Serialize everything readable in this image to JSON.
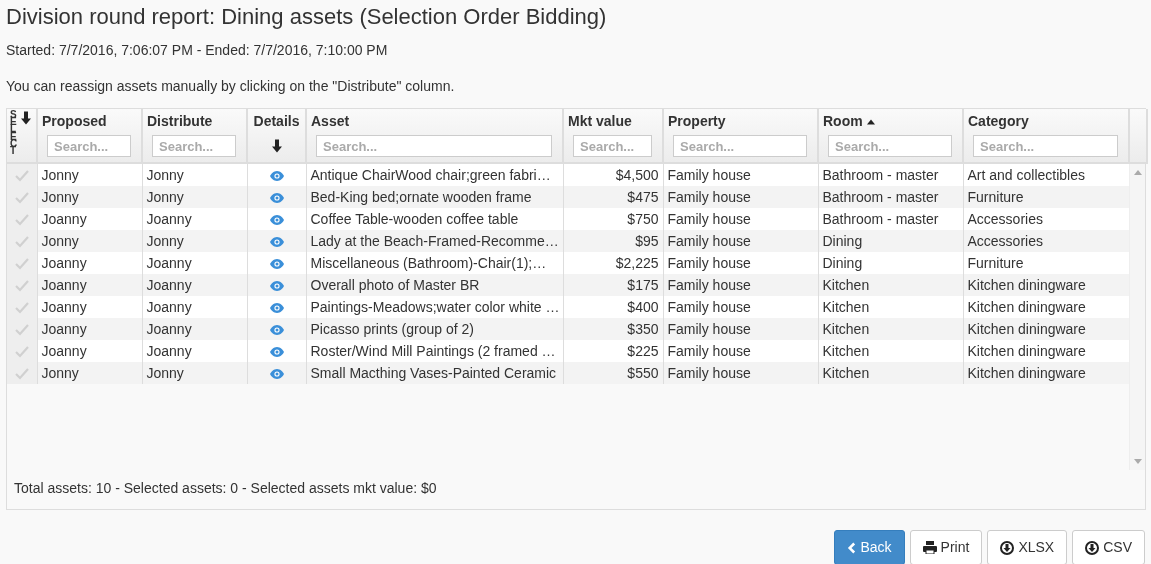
{
  "title": "Division round report: Dining assets (Selection Order Bidding)",
  "times": "Started: 7/7/2016, 7:06:07 PM - Ended: 7/7/2016, 7:10:00 PM",
  "hint": "You can reassign assets manually by clicking on the \"Distribute\" column.",
  "columns": [
    {
      "kind": "select",
      "label": "SELECT"
    },
    {
      "kind": "search",
      "label": "Proposed",
      "placeholder": "Search..."
    },
    {
      "kind": "search",
      "label": "Distribute",
      "placeholder": "Search..."
    },
    {
      "kind": "details",
      "label": "Details"
    },
    {
      "kind": "search",
      "label": "Asset",
      "placeholder": "Search..."
    },
    {
      "kind": "search",
      "label": "Mkt value",
      "placeholder": "Search..."
    },
    {
      "kind": "search",
      "label": "Property",
      "placeholder": "Search..."
    },
    {
      "kind": "search",
      "label": "Room",
      "placeholder": "Search...",
      "sorted_ascending": true
    },
    {
      "kind": "search",
      "label": "Category",
      "placeholder": "Search..."
    }
  ],
  "rows": [
    {
      "selected": false,
      "proposed": "Jonny",
      "distribute": "Jonny",
      "asset": "Antique ChairWood chair;green fabri…",
      "value": "$4,500",
      "property": "Family house",
      "room": "Bathroom - master",
      "category": "Art and collectibles"
    },
    {
      "selected": false,
      "proposed": "Jonny",
      "distribute": "Jonny",
      "asset": "Bed-King bed;ornate wooden frame",
      "value": "$475",
      "property": "Family house",
      "room": "Bathroom - master",
      "category": "Furniture"
    },
    {
      "selected": false,
      "proposed": "Joanny",
      "distribute": "Joanny",
      "asset": "Coffee Table-wooden coffee table",
      "value": "$750",
      "property": "Family house",
      "room": "Bathroom - master",
      "category": "Accessories"
    },
    {
      "selected": false,
      "proposed": "Jonny",
      "distribute": "Jonny",
      "asset": "Lady at the Beach-Framed-Recomme…",
      "value": "$95",
      "property": "Family house",
      "room": "Dining",
      "category": "Accessories"
    },
    {
      "selected": false,
      "proposed": "Joanny",
      "distribute": "Joanny",
      "asset": "Miscellaneous (Bathroom)-Chair(1);…",
      "value": "$2,225",
      "property": "Family house",
      "room": "Dining",
      "category": "Furniture"
    },
    {
      "selected": false,
      "proposed": "Joanny",
      "distribute": "Joanny",
      "asset": "Overall photo of Master BR",
      "value": "$175",
      "property": "Family house",
      "room": "Kitchen",
      "category": "Kitchen diningware"
    },
    {
      "selected": false,
      "proposed": "Joanny",
      "distribute": "Joanny",
      "asset": "Paintings-Meadows;water color white …",
      "value": "$400",
      "property": "Family house",
      "room": "Kitchen",
      "category": "Kitchen diningware"
    },
    {
      "selected": false,
      "proposed": "Joanny",
      "distribute": "Joanny",
      "asset": "Picasso prints (group of 2)",
      "value": "$350",
      "property": "Family house",
      "room": "Kitchen",
      "category": "Kitchen diningware"
    },
    {
      "selected": false,
      "proposed": "Joanny",
      "distribute": "Joanny",
      "asset": "Roster/Wind Mill Paintings (2 framed …",
      "value": "$225",
      "property": "Family house",
      "room": "Kitchen",
      "category": "Kitchen diningware"
    },
    {
      "selected": false,
      "proposed": "Jonny",
      "distribute": "Jonny",
      "asset": "Small Macthing Vases-Painted Ceramic",
      "value": "$550",
      "property": "Family house",
      "room": "Kitchen",
      "category": "Kitchen diningware"
    }
  ],
  "summary": "Total assets: 10 - Selected assets: 0 - Selected assets mkt value: $0",
  "buttons": [
    {
      "kind": "back",
      "label": "Back",
      "primary": true
    },
    {
      "kind": "print",
      "label": "Print",
      "primary": false
    },
    {
      "kind": "download",
      "label": "XLSX",
      "primary": false
    },
    {
      "kind": "download",
      "label": "CSV",
      "primary": false
    }
  ]
}
